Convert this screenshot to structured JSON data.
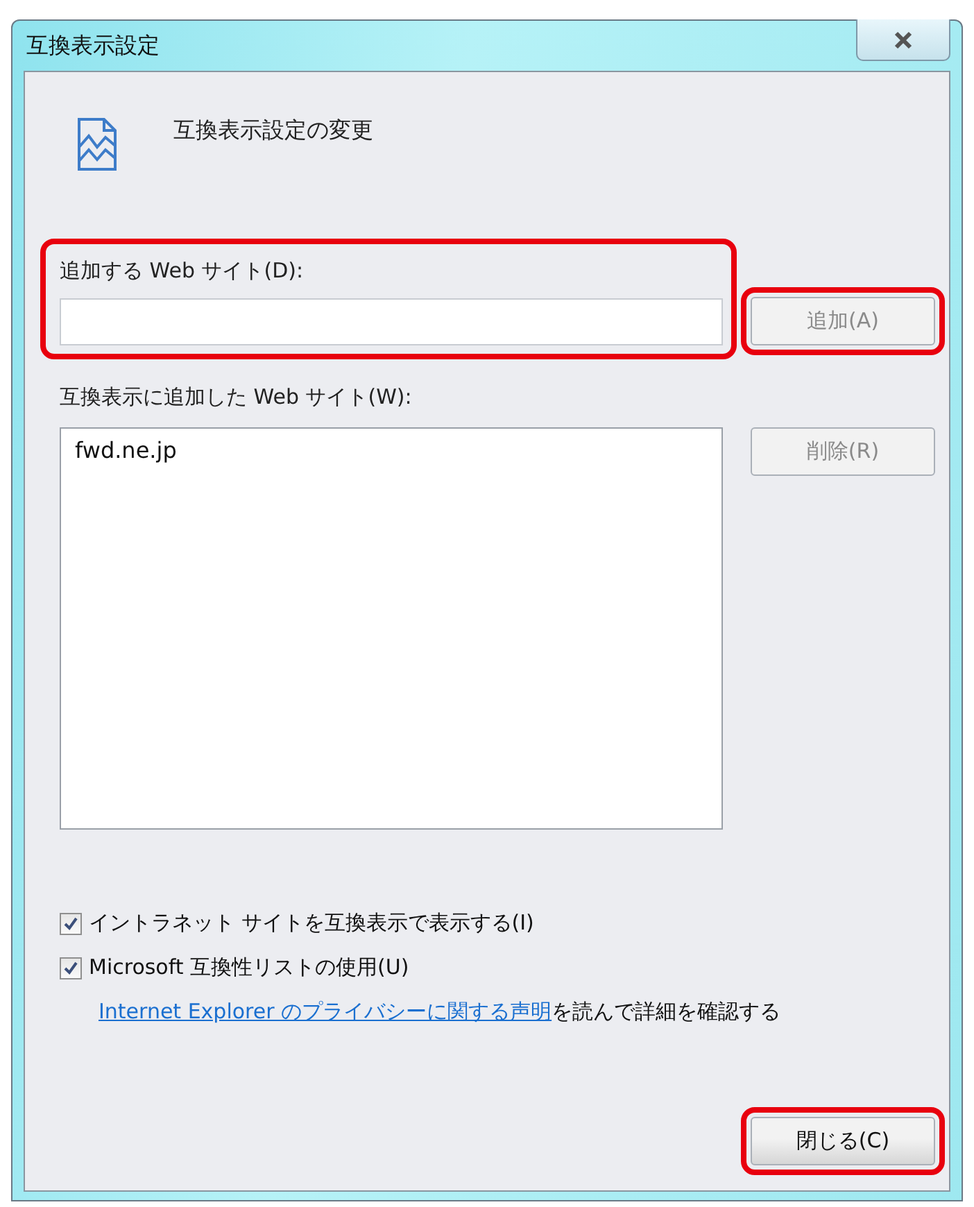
{
  "window": {
    "title": "互換表示設定"
  },
  "heading": "互換表示設定の変更",
  "add_site": {
    "label": "追加する Web サイト(D):",
    "highlighted": true
  },
  "add_button": {
    "label": "追加(A)",
    "disabled": true,
    "highlighted": true
  },
  "site_list": {
    "label": "互換表示に追加した Web サイト(W):",
    "items": [
      {
        "text": "fwd.ne.jp",
        "selected": false
      }
    ]
  },
  "remove_button": {
    "label": "削除(R)",
    "disabled": true
  },
  "options": [
    {
      "label": "イントラネット サイトを互換表示で表示する(I)",
      "checked": true
    },
    {
      "label": "Microsoft 互換性リストの使用(U)",
      "checked": true
    }
  ],
  "privacy": {
    "link": "Internet Explorer のプライバシーに関する声明",
    "text": "を読んで詳細を確認する"
  },
  "close_button": {
    "label": "閉じる(C)",
    "disabled": false,
    "highlighted": true
  }
}
